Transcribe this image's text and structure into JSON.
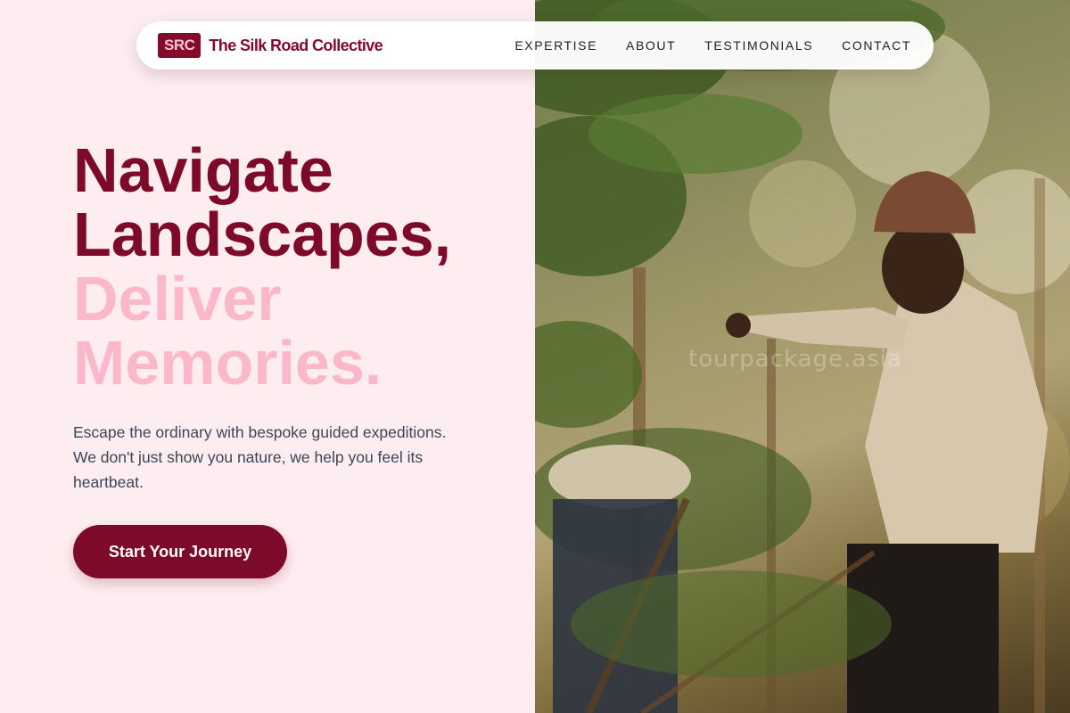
{
  "brand": {
    "badge": "SRC",
    "name": "The Silk Road Collective"
  },
  "nav": {
    "items": [
      {
        "label": "EXPERTISE"
      },
      {
        "label": "ABOUT"
      },
      {
        "label": "TESTIMONIALS"
      },
      {
        "label": "CONTACT"
      }
    ]
  },
  "hero": {
    "headline_line1": "Navigate",
    "headline_line2": "Landscapes,",
    "headline_line3": "Deliver",
    "headline_line4": "Memories.",
    "subcopy": "Escape the ordinary with bespoke guided expeditions. We don't just show you nature, we help you feel its heartbeat.",
    "cta_label": "Start Your Journey"
  },
  "photo": {
    "watermark": "tourpackage.asia"
  },
  "colors": {
    "brand_maroon": "#7d0a28",
    "accent_pink": "#fbb8cb",
    "background_pink": "#fdedf1"
  }
}
